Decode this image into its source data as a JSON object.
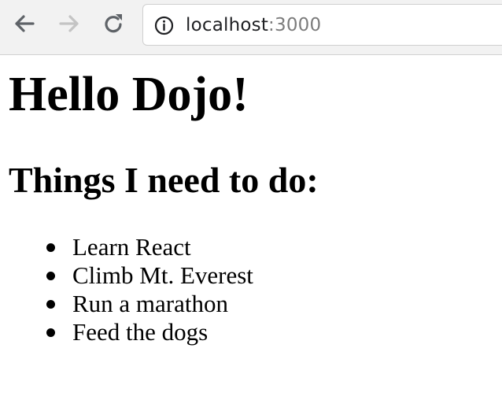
{
  "browser": {
    "address_bar": {
      "host": "localhost",
      "port": ":3000"
    },
    "icons": {
      "back": "back-arrow-icon",
      "forward": "forward-arrow-icon",
      "reload": "reload-icon",
      "info": "info-icon"
    },
    "colors": {
      "toolbar_background": "#f2f2f2",
      "icon_active": "#5f6368",
      "icon_disabled": "#c4c4c4",
      "url_port": "#7c7c7c"
    }
  },
  "page": {
    "title": "Hello Dojo!",
    "heading": "Things I need to do:",
    "todos": [
      "Learn React",
      "Climb Mt. Everest",
      "Run a marathon",
      "Feed the dogs"
    ]
  }
}
